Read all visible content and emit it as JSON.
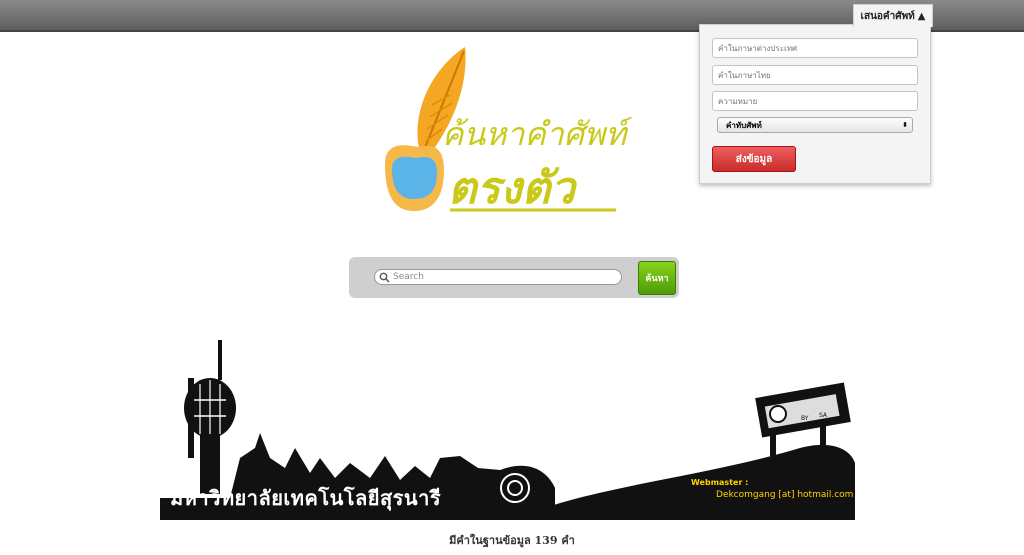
{
  "top_bar": {
    "propose_tab_label": "เสนอคำศัพท์",
    "propose_tab_arrow": "▲"
  },
  "propose_form": {
    "foreign_word_placeholder": "คำในภาษาต่างประเทศ",
    "thai_word_placeholder": "คำในภาษาไทย",
    "meaning_placeholder": "ความหมาย",
    "category_select": "คำทับศัพท์",
    "submit_label": "ส่งข้อมูล"
  },
  "logo": {
    "line1": "ค้นหาคำศัพท์",
    "line2": "ตรงตัว"
  },
  "search": {
    "placeholder": "Search",
    "button_label": "ค้นหา"
  },
  "banner": {
    "university_name": "มหาวิทยาลัยเทคโนโลยีสุรนารี",
    "webmaster_label": "Webmaster :",
    "webmaster_email": "Dekcomgang [at] hotmail.com",
    "license_badges": [
      "BY",
      "SA"
    ]
  },
  "footer": {
    "word_count_text": "มีคำในฐานข้อมูล 139 คำ"
  },
  "colors": {
    "logo_text": "#c9c91a",
    "quill": "#f5a623",
    "search_button": "#6cbf12",
    "submit_button": "#d83a3a"
  }
}
